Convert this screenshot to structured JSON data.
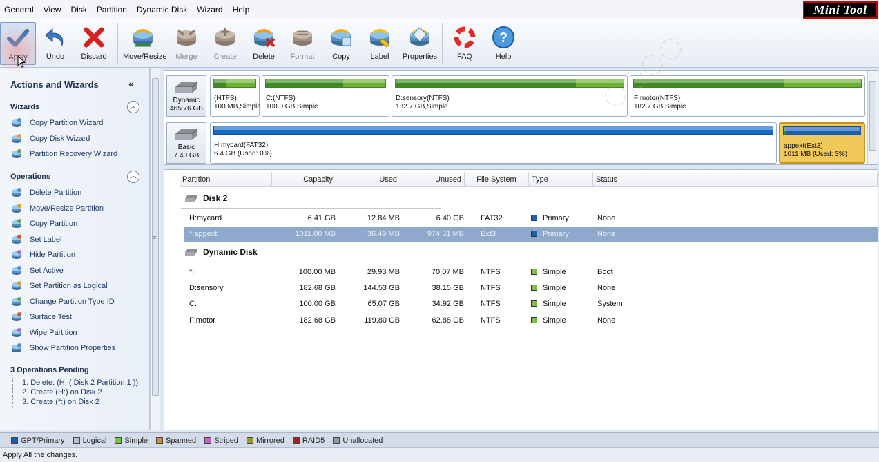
{
  "menu": [
    "General",
    "View",
    "Disk",
    "Partition",
    "Dynamic Disk",
    "Wizard",
    "Help"
  ],
  "brand": {
    "part1": "Mini",
    "part2": "Tool"
  },
  "toolbar": [
    {
      "key": "apply",
      "label": "Apply",
      "icon": "checkmark-icon",
      "enabled": true
    },
    {
      "key": "undo",
      "label": "Undo",
      "icon": "undo-arrow-icon",
      "enabled": true
    },
    {
      "key": "discard",
      "label": "Discard",
      "icon": "red-x-icon",
      "enabled": true
    },
    {
      "key": "move-resize",
      "label": "Move/Resize",
      "icon": "move-resize-disk-icon",
      "enabled": true
    },
    {
      "key": "merge",
      "label": "Merge",
      "icon": "merge-disk-icon",
      "enabled": false
    },
    {
      "key": "create",
      "label": "Create",
      "icon": "create-disk-icon",
      "enabled": false
    },
    {
      "key": "delete",
      "label": "Delete",
      "icon": "delete-disk-icon",
      "enabled": true
    },
    {
      "key": "format",
      "label": "Format",
      "icon": "format-disk-icon",
      "enabled": false
    },
    {
      "key": "copy",
      "label": "Copy",
      "icon": "copy-disk-icon",
      "enabled": true
    },
    {
      "key": "label",
      "label": "Label",
      "icon": "label-disk-icon",
      "enabled": true
    },
    {
      "key": "properties",
      "label": "Properties",
      "icon": "properties-disk-icon",
      "enabled": true
    },
    {
      "key": "faq",
      "label": "FAQ",
      "icon": "lifebuoy-icon",
      "enabled": true
    },
    {
      "key": "help",
      "label": "Help",
      "icon": "question-icon",
      "enabled": true
    }
  ],
  "left": {
    "title": "Actions and Wizards",
    "wizards_header": "Wizards",
    "wizards": [
      "Copy Partition Wizard",
      "Copy Disk Wizard",
      "Partition Recovery Wizard"
    ],
    "operations_header": "Operations",
    "operations": [
      "Delete Partition",
      "Move/Resize Partition",
      "Copy Partition",
      "Set Label",
      "Hide Partition",
      "Set Active",
      "Set Partition as Logical",
      "Change Partition Type ID",
      "Surface Test",
      "Wipe Partition",
      "Show Partition Properties"
    ],
    "pending_header": "3 Operations Pending",
    "pending": [
      "1. Delete: (H: ( Disk 2 Partition 1 ))",
      "2. Create (H:) on Disk 2",
      "3. Create (*:) on Disk 2"
    ]
  },
  "diskmap": {
    "dynamic": {
      "type": "Dynamic",
      "size": "465.76 GB",
      "parts": [
        {
          "name": "(NTFS)",
          "info": "100 MB,Simple",
          "used": 0.3
        },
        {
          "name": "C:(NTFS)",
          "info": "100.0 GB,Simple",
          "used": 0.65
        },
        {
          "name": "D:sensory(NTFS)",
          "info": "182.7 GB,Simple",
          "used": 0.79
        },
        {
          "name": "F:motor(NTFS)",
          "info": "182.7 GB,Simple",
          "used": 0.66
        }
      ]
    },
    "basic": {
      "type": "Basic",
      "size": "7.40 GB",
      "parts": [
        {
          "name": "H:mycard(FAT32)",
          "info": "6.4 GB (Used: 0%)",
          "used": 0.0
        },
        {
          "name": "appext(Ext3)",
          "info": "1011 MB (Used: 3%)",
          "used": 0.03
        }
      ]
    }
  },
  "list": {
    "headers": [
      "Partition",
      "Capacity",
      "Used",
      "Unused",
      "File System",
      "Type",
      "Status"
    ],
    "groups": [
      {
        "name": "Disk 2",
        "rows": [
          {
            "partition": "H:mycard",
            "capacity": "6.41 GB",
            "used": "12.84 MB",
            "unused": "6.40 GB",
            "fs": "FAT32",
            "type": "Primary",
            "status": "None",
            "selected": false
          },
          {
            "partition": "*:appext",
            "capacity": "1011.00 MB",
            "used": "36.49 MB",
            "unused": "974.51 MB",
            "fs": "Ext3",
            "type": "Primary",
            "status": "None",
            "selected": true
          }
        ]
      },
      {
        "name": "Dynamic Disk",
        "rows": [
          {
            "partition": "*:",
            "capacity": "100.00 MB",
            "used": "29.93 MB",
            "unused": "70.07 MB",
            "fs": "NTFS",
            "type": "Simple",
            "status": "Boot",
            "selected": false
          },
          {
            "partition": "D:sensory",
            "capacity": "182.68 GB",
            "used": "144.53 GB",
            "unused": "38.15 GB",
            "fs": "NTFS",
            "type": "Simple",
            "status": "None",
            "selected": false
          },
          {
            "partition": "C:",
            "capacity": "100.00 GB",
            "used": "65.07 GB",
            "unused": "34.92 GB",
            "fs": "NTFS",
            "type": "Simple",
            "status": "System",
            "selected": false
          },
          {
            "partition": "F:motor",
            "capacity": "182.68 GB",
            "used": "119.80 GB",
            "unused": "62.88 GB",
            "fs": "NTFS",
            "type": "Simple",
            "status": "None",
            "selected": false
          }
        ]
      }
    ]
  },
  "legend": [
    {
      "label": "GPT/Primary",
      "color": "#1f5fae"
    },
    {
      "label": "Logical",
      "color": "#b9c4d0"
    },
    {
      "label": "Simple",
      "color": "#7cc242"
    },
    {
      "label": "Spanned",
      "color": "#e08a2a"
    },
    {
      "label": "Striped",
      "color": "#c35fc9"
    },
    {
      "label": "Mirrored",
      "color": "#9a9a24"
    },
    {
      "label": "RAID5",
      "color": "#a52020"
    },
    {
      "label": "Unallocated",
      "color": "#9a9a9a"
    }
  ],
  "type_colors": {
    "Primary": "#1f5fae",
    "Simple": "#7cc242"
  },
  "status_text": "Apply All the changes."
}
